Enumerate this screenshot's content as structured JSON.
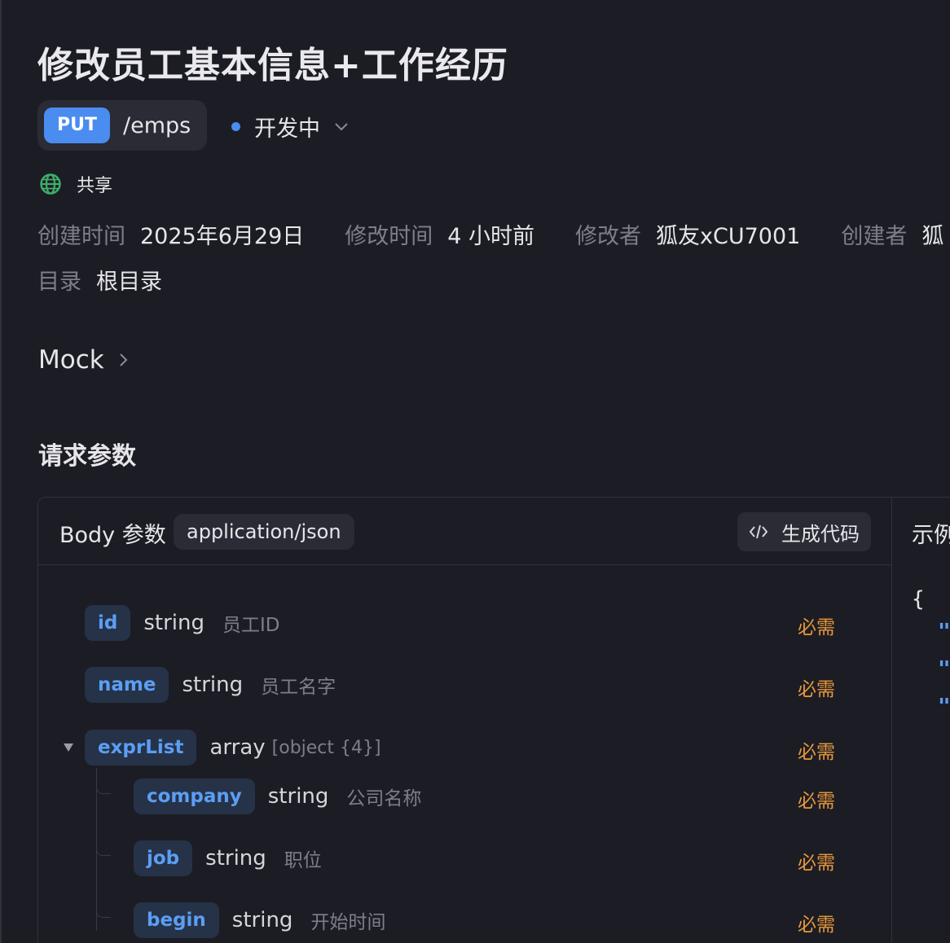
{
  "title": "修改员工基本信息+工作经历",
  "method": "PUT",
  "path": "/emps",
  "status": {
    "label": "开发中",
    "color": "#4a8cf0"
  },
  "share": {
    "icon": "globe-icon",
    "label": "共享",
    "color": "#3fae6a"
  },
  "meta": {
    "created_label": "创建时间",
    "created_value": "2025年6月29日",
    "modified_label": "修改时间",
    "modified_value": "4 小时前",
    "modifier_label": "修改者",
    "modifier_value": "狐友xCU7001",
    "creator_label": "创建者",
    "creator_value": "狐",
    "directory_label": "目录",
    "directory_value": "根目录"
  },
  "mock": {
    "label": "Mock",
    "icon": "chevron-right-icon"
  },
  "request_section_title": "请求参数",
  "body_panel": {
    "label": "Body 参数",
    "content_type": "application/json",
    "generate_code_label": "生成代码",
    "generate_code_icon": "code-icon",
    "example_label": "示例",
    "example_open_brace": "{",
    "example_quote": "\""
  },
  "params": [
    {
      "name": "id",
      "type": "string",
      "type_extra": "",
      "desc": "员工ID",
      "required": "必需"
    },
    {
      "name": "name",
      "type": "string",
      "type_extra": "",
      "desc": "员工名字",
      "required": "必需"
    },
    {
      "name": "exprList",
      "type": "array",
      "type_extra": "[object {4}]",
      "desc": "",
      "required": "必需"
    },
    {
      "name": "company",
      "type": "string",
      "type_extra": "",
      "desc": "公司名称",
      "required": "必需"
    },
    {
      "name": "job",
      "type": "string",
      "type_extra": "",
      "desc": "职位",
      "required": "必需"
    },
    {
      "name": "begin",
      "type": "string",
      "type_extra": "",
      "desc": "开始时间",
      "required": "必需"
    }
  ],
  "colors": {
    "background": "#1c1d24",
    "accent": "#4a8cf0",
    "param_name": "#5b9ef5",
    "required": "#e9983a"
  }
}
